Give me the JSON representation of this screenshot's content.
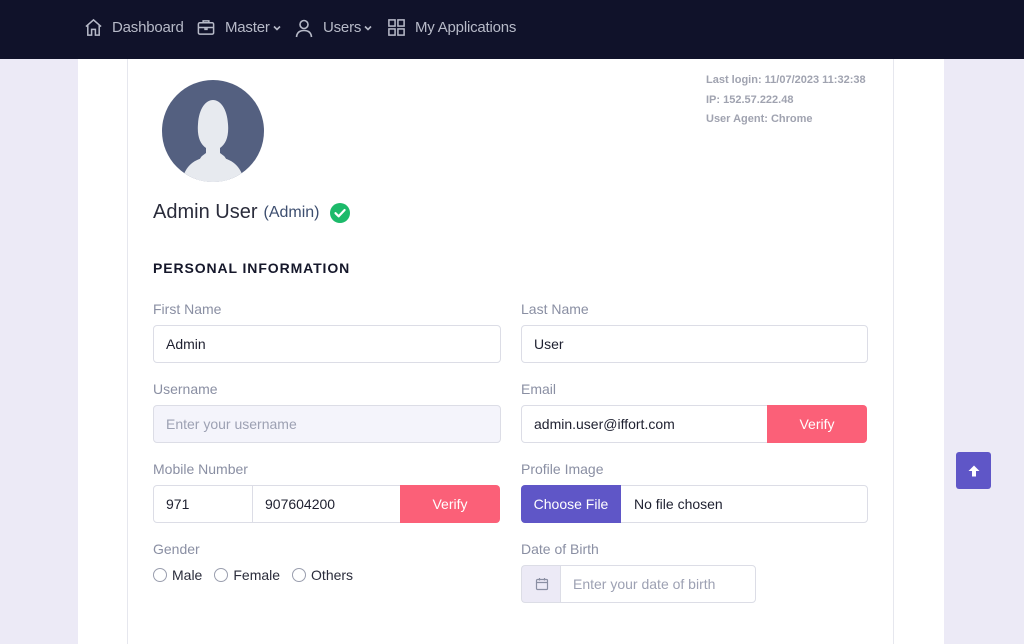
{
  "nav": {
    "items": [
      {
        "label": "Dashboard",
        "icon": "home-icon"
      },
      {
        "label": "Master",
        "icon": "briefcase-icon",
        "dropdown": true
      },
      {
        "label": "Users",
        "icon": "user-icon",
        "dropdown": true
      },
      {
        "label": "My Applications",
        "icon": "grid-icon"
      }
    ]
  },
  "login_info": {
    "last_login": "Last login: 11/07/2023 11:32:38",
    "ip": "IP: 152.57.222.48",
    "user_agent": "User Agent: Chrome"
  },
  "profile": {
    "name": "Admin User",
    "role": "(Admin)",
    "verified_color": "#1cba6a"
  },
  "section_title": "PERSONAL INFORMATION",
  "form": {
    "first_name": {
      "label": "First Name",
      "value": "Admin"
    },
    "last_name": {
      "label": "Last Name",
      "value": "User"
    },
    "username": {
      "label": "Username",
      "placeholder": "Enter your username"
    },
    "email": {
      "label": "Email",
      "value": "admin.user@iffort.com",
      "verify_label": "Verify"
    },
    "mobile": {
      "label": "Mobile Number",
      "code": "971",
      "number": "907604200",
      "verify_label": "Verify"
    },
    "profile_image": {
      "label": "Profile Image",
      "button": "Choose File",
      "status": "No file chosen"
    },
    "gender": {
      "label": "Gender",
      "options": [
        "Male",
        "Female",
        "Others"
      ]
    },
    "dob": {
      "label": "Date of Birth",
      "placeholder": "Enter your date of birth"
    }
  },
  "colors": {
    "nav_bg": "#10122a",
    "accent": "#5f56c7",
    "verify": "#fb6078"
  }
}
